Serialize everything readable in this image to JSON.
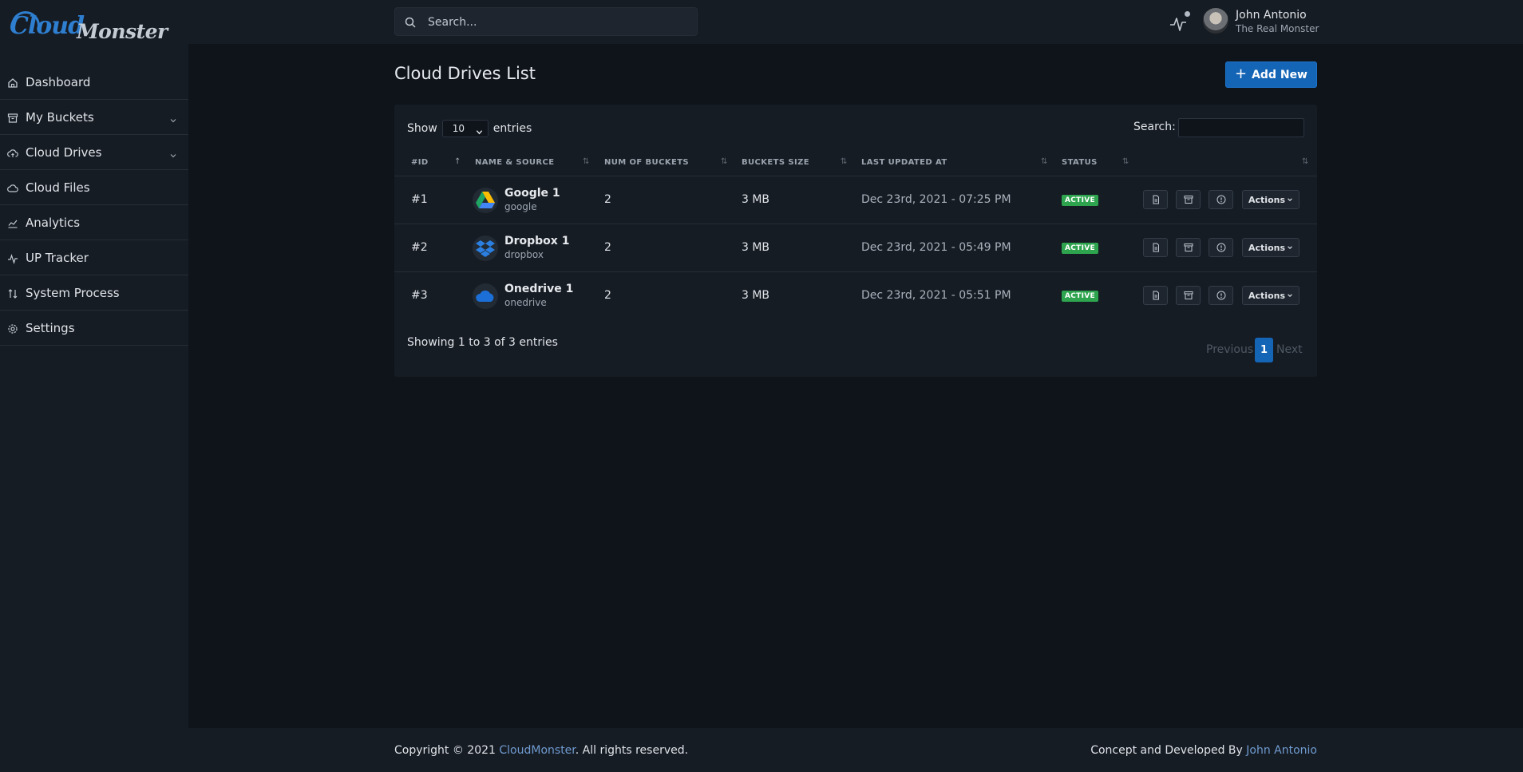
{
  "app": {
    "logo_part1": "Cloud",
    "logo_part2": "Monster"
  },
  "header": {
    "search_placeholder": "Search...",
    "user_name": "John Antonio",
    "user_role": "The Real Monster"
  },
  "sidebar": {
    "items": [
      {
        "label": "Dashboard",
        "icon": "home-icon"
      },
      {
        "label": "My Buckets",
        "icon": "archive-icon",
        "has_submenu": true
      },
      {
        "label": "Cloud Drives",
        "icon": "cloud-upload-icon",
        "has_submenu": true
      },
      {
        "label": "Cloud Files",
        "icon": "cloud-icon"
      },
      {
        "label": "Analytics",
        "icon": "chart-icon"
      },
      {
        "label": "UP Tracker",
        "icon": "activity-icon"
      },
      {
        "label": "System Process",
        "icon": "arrows-updown-icon"
      },
      {
        "label": "Settings",
        "icon": "gear-icon"
      }
    ]
  },
  "main": {
    "title": "Cloud Drives List",
    "add_button": "Add New",
    "show_label": "Show",
    "entries_label": "entries",
    "page_length": "10",
    "search_label": "Search:",
    "columns": [
      "#ID",
      "NAME & SOURCE",
      "NUM OF BUCKETS",
      "BUCKETS SIZE",
      "LAST UPDATED AT",
      "STATUS"
    ],
    "rows": [
      {
        "id": "#1",
        "name": "Google 1",
        "source": "google",
        "buckets": "2",
        "size": "3 MB",
        "updated": "Dec 23rd, 2021 - 07:25 PM",
        "status": "ACTIVE",
        "icon": "google-drive-icon"
      },
      {
        "id": "#2",
        "name": "Dropbox 1",
        "source": "dropbox",
        "buckets": "2",
        "size": "3 MB",
        "updated": "Dec 23rd, 2021 - 05:49 PM",
        "status": "ACTIVE",
        "icon": "dropbox-icon"
      },
      {
        "id": "#3",
        "name": "Onedrive 1",
        "source": "onedrive",
        "buckets": "2",
        "size": "3 MB",
        "updated": "Dec 23rd, 2021 - 05:51 PM",
        "status": "ACTIVE",
        "icon": "onedrive-icon"
      }
    ],
    "actions_label": "Actions",
    "showing_text": "Showing 1 to 3 of 3 entries",
    "pagination": {
      "previous": "Previous",
      "current": "1",
      "next": "Next"
    }
  },
  "footer": {
    "copy_prefix": "Copyright © 2021 ",
    "copy_link": "CloudMonster",
    "copy_suffix": ". All rights reserved.",
    "credit_prefix": "Concept and Developed By ",
    "credit_link": "John Antonio"
  },
  "colors": {
    "accent": "#1565b7",
    "status_active": "#2ea44f",
    "background": "#0f141b",
    "panel": "#161c24"
  }
}
